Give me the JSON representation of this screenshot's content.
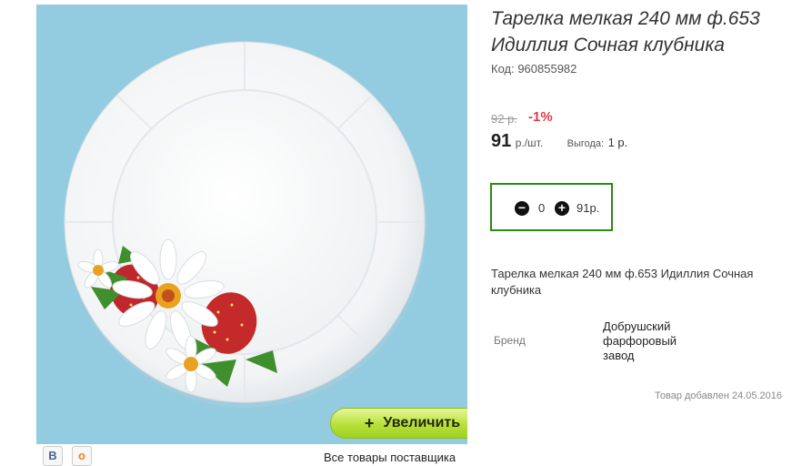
{
  "product": {
    "title_line1": "Тарелка мелкая 240 мм ф.653",
    "title_line2": "Идиллия Сочная клубника",
    "code": "Код: 960855982",
    "old_price": "92 р.",
    "discount": "-1%",
    "price": "91",
    "price_unit": "р./шт.",
    "benefit_label": "Выгода:",
    "benefit_value": "1 р.",
    "description": "Тарелка мелкая 240 мм ф.653 Идиллия Сочная клубника",
    "brand_label": "Бренд",
    "brand_value": "Добрушский фарфоровый завод",
    "added": "Товар добавлен 24.05.2016"
  },
  "cart": {
    "minus_icon": "minus-icon",
    "plus_icon": "plus-icon",
    "quantity": "0",
    "sum": "91р."
  },
  "gallery": {
    "zoom_label": "Увеличить",
    "zoom_icon": "+",
    "all_goods_link": "Все товары поставщика",
    "share": [
      "vk-icon",
      "odnoklassniki-icon"
    ],
    "share_vk_glyph": "В",
    "share_ok_glyph": "о",
    "background_color": "#93cbe0"
  },
  "colors": {
    "accent_border": "#2b8a12",
    "discount": "#e23a4a",
    "button": "#b8e03a"
  }
}
